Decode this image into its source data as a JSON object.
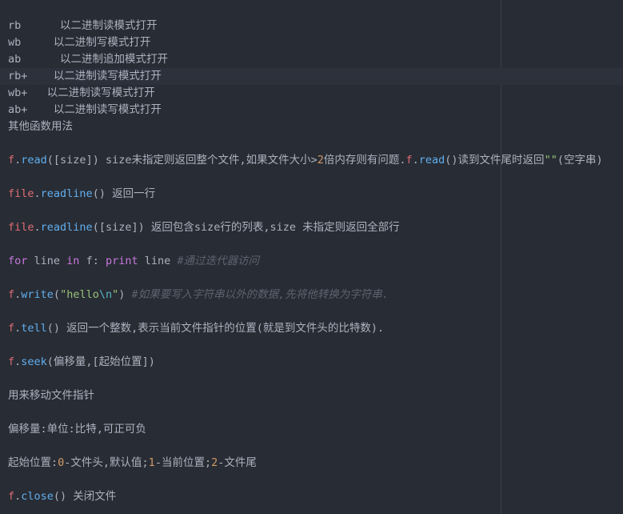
{
  "modes": [
    {
      "mode": "rb",
      "sep": "      ",
      "desc": "以二进制读模式打开"
    },
    {
      "mode": "wb",
      "sep": "     ",
      "desc": "以二进制写模式打开"
    },
    {
      "mode": "ab",
      "sep": "      ",
      "desc": "以二进制追加模式打开"
    },
    {
      "mode": "rb+",
      "sep": "    ",
      "desc": "以二进制读写模式打开"
    },
    {
      "mode": "wb+",
      "sep": "   ",
      "desc": "以二进制读写模式打开"
    },
    {
      "mode": "ab+",
      "sep": "    ",
      "desc": "以二进制读写模式打开"
    }
  ],
  "heading": "其他函数用法",
  "read": {
    "obj": "f",
    "dot": ".",
    "fn": "read",
    "args": "([size]) size未指定则返回整个文件,如果文件大小>",
    "num": "2",
    "tail": "倍内存则有问题.",
    "obj2": "f",
    "dot2": ".",
    "fn2": "read",
    "tail2": "()读到文件尾时返回",
    "str": "\"\"",
    "tail3": "(空字串)"
  },
  "readline1": {
    "obj": "file",
    "dot": ".",
    "fn": "readline",
    "rest": "() 返回一行"
  },
  "readline2": {
    "obj": "file",
    "dot": ".",
    "fn": "readline",
    "rest": "([size]) 返回包含size行的列表,size 未指定则返回全部行"
  },
  "forloop": {
    "kw1": "for",
    "var": " line ",
    "kw2": "in",
    "it": " f: ",
    "kw3": "print",
    "var2": " line ",
    "comment": "#通过迭代器访问"
  },
  "write": {
    "obj": "f",
    "dot": ".",
    "fn": "write",
    "open": "(",
    "str": "\"hello",
    "esc": "\\n",
    "strend": "\"",
    "close": ") ",
    "comment": "#如果要写入字符串以外的数据,先将他转换为字符串."
  },
  "tell": {
    "obj": "f",
    "dot": ".",
    "fn": "tell",
    "rest": "() 返回一个整数,表示当前文件指针的位置(就是到文件头的比特数)."
  },
  "seek": {
    "obj": "f",
    "dot": ".",
    "fn": "seek",
    "rest": "(偏移量,[起始位置])"
  },
  "move_desc": "用来移动文件指针",
  "offset_desc": "偏移量:单位:比特,可正可负",
  "origin": {
    "p1": "起始位置:",
    "n0": "0",
    "p2": "-文件头,默认值;",
    "n1": "1",
    "p3": "-当前位置;",
    "n2": "2",
    "p4": "-文件尾"
  },
  "close": {
    "obj": "f",
    "dot": ".",
    "fn": "close",
    "rest": "() 关闭文件"
  }
}
